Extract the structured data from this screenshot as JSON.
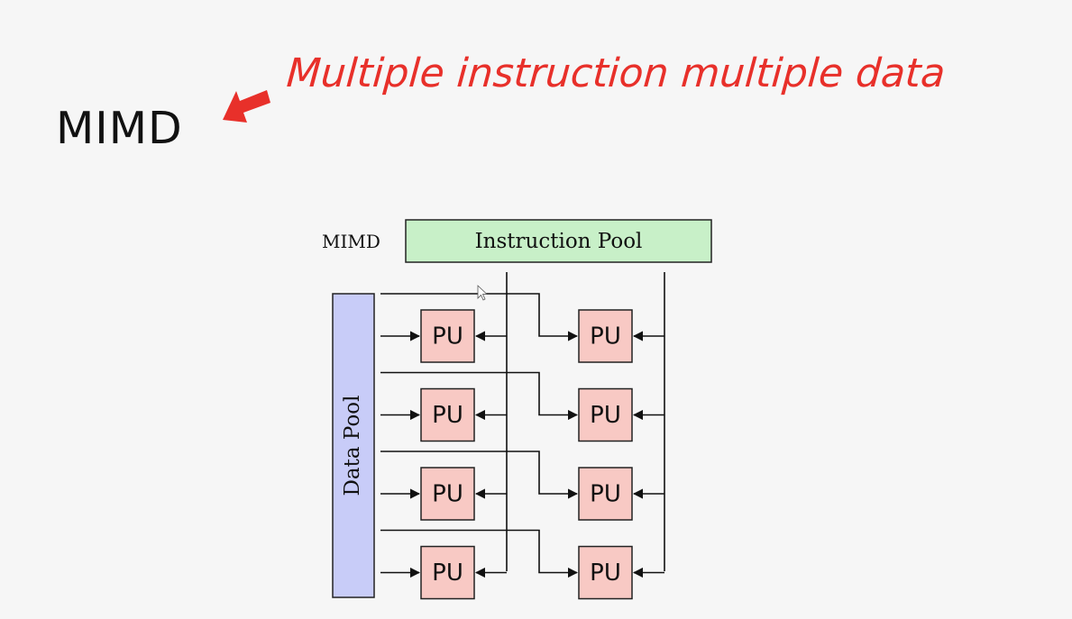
{
  "slide": {
    "title": "MIMD",
    "annotation": "Multiple instruction multiple data"
  },
  "diagram": {
    "side_label": "MIMD",
    "instruction_pool": "Instruction Pool",
    "data_pool": "Data Pool",
    "pu_label": "PU",
    "rows": 4,
    "columns": 2,
    "colors": {
      "instruction_pool_fill": "#c8f0c8",
      "data_pool_fill": "#c8ccf8",
      "pu_fill": "#f8c9c4",
      "annotation": "#e8302a"
    }
  }
}
